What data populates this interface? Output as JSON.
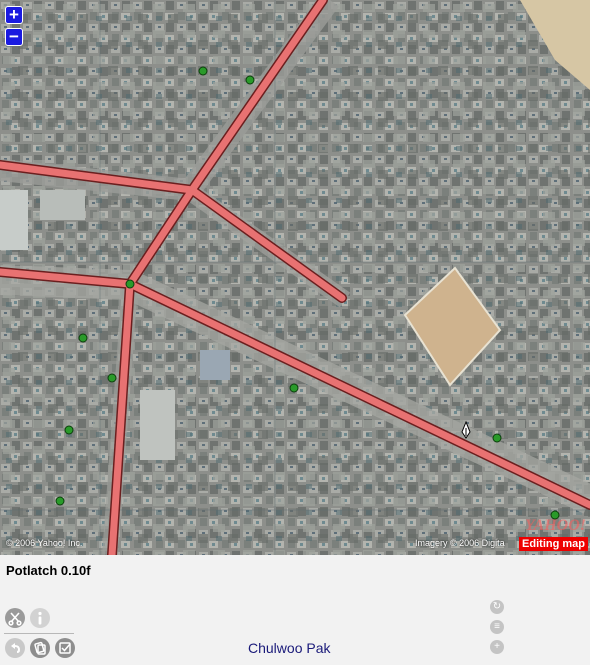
{
  "map": {
    "zoom_in_label": "+",
    "zoom_out_label": "−",
    "credit_left": "© 2006 Yahoo! Inc.",
    "credit_right": "Imagery © 2006 Digita",
    "logo_text": "YAHOO!",
    "editing_label": "Editing map",
    "road_color": "#e87272",
    "node_color": "#2a9a2a"
  },
  "panel": {
    "app_title": "Potlatch 0.10f",
    "user_name": "Chulwoo Pak",
    "tools": [
      "scissors-icon",
      "info-icon",
      "undo-icon",
      "copy-icon",
      "tick-icon"
    ],
    "mini_tools": [
      "refresh-icon",
      "tags-icon",
      "add-icon"
    ]
  }
}
